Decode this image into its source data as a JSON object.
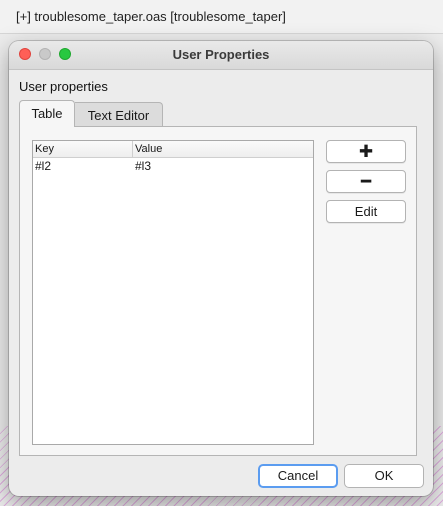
{
  "background_window": {
    "title": "[+] troublesome_taper.oas [troublesome_taper]"
  },
  "dialog": {
    "title": "User Properties",
    "section_label": "User properties",
    "tabs": [
      {
        "label": "Table",
        "active": true
      },
      {
        "label": "Text Editor",
        "active": false
      }
    ],
    "table": {
      "columns": [
        "Key",
        "Value"
      ],
      "rows": [
        {
          "key": "#l2",
          "value": "#l3"
        }
      ]
    },
    "side_buttons": {
      "add_label": "✚",
      "remove_label": "━",
      "edit_label": "Edit"
    },
    "footer": {
      "cancel_label": "Cancel",
      "ok_label": "OK"
    }
  },
  "colors": {
    "close": "#ff5f57",
    "minimize": "#c9c9c9",
    "maximize": "#28c840",
    "focus_ring": "#5b9cf0"
  }
}
